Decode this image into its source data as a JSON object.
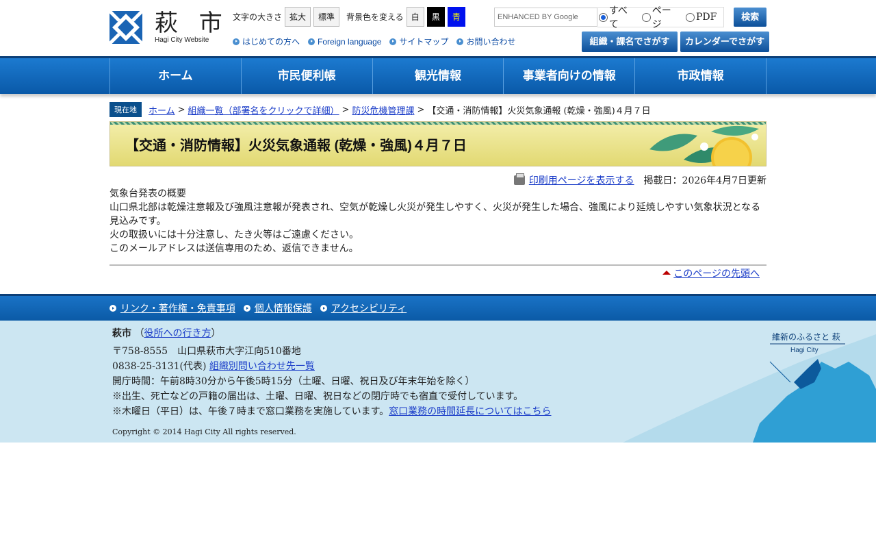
{
  "header": {
    "logo_kanji": "萩 市",
    "logo_sub": "Hagi City Website",
    "font_size_label": "文字の大きさ",
    "font_size_buttons": [
      "拡大",
      "標準"
    ],
    "bg_color_label": "背景色を変える",
    "bg_color_buttons": [
      "白",
      "黒",
      "青"
    ],
    "quicklinks": [
      "はじめての方へ",
      "Foreign language",
      "サイトマップ",
      "お問い合わせ"
    ],
    "search": {
      "placeholder": "ENHANCED BY Google",
      "options": [
        "すべて",
        "ページ",
        "PDF"
      ],
      "selected": "すべて",
      "button": "検索"
    },
    "big_buttons": [
      "組織・課名でさがす",
      "カレンダーでさがす"
    ]
  },
  "nav": [
    "ホーム",
    "市民便利帳",
    "観光情報",
    "事業者向けの情報",
    "市政情報"
  ],
  "breadcrumb": {
    "label": "現在地",
    "links": [
      "ホーム",
      "組織一覧（部署名をクリックで詳細）",
      "防災危機管理課"
    ],
    "current": "【交通・消防情報】火災気象通報 (乾燥・強風)４月７日"
  },
  "page": {
    "title": "【交通・消防情報】火災気象通報 (乾燥・強風)４月７日",
    "print_link": "印刷用ページを表示する",
    "date": "掲載日：2026年4月7日更新",
    "body": [
      "気象台発表の概要",
      "山口県北部は乾燥注意報及び強風注意報が発表され、空気が乾燥し火災が発生しやすく、火災が発生した場合、強風により延焼しやすい気象状況となる見込みです。",
      "火の取扱いには十分注意し、たき火等はご遠慮ください。",
      "このメールアドレスは送信専用のため、返信できません。"
    ],
    "pagetop": "このページの先頭へ"
  },
  "footer": {
    "links": [
      "リンク・著作権・免責事項",
      "個人情報保護",
      "アクセシビリティ"
    ],
    "name": "萩市",
    "access_link": "役所への行き方",
    "address": "〒758-8555　山口県萩市大字江向510番地",
    "phone": "0838-25-3131(代表)",
    "contact_link": "組織別問い合わせ先一覧",
    "hours": "開庁時間：午前8時30分から午後5時15分（土曜、日曜、祝日及び年末年始を除く）",
    "note1": "※出生、死亡などの戸籍の届出は、土曜、日曜、祝日などの閉庁時でも宿直で受付しています。",
    "note2": "※木曜日（平日）は、午後７時まで窓口業務を実施しています。",
    "note2_link": "窓口業務の時間延長についてはこちら",
    "copyright": "Copyright © 2014 Hagi City All rights reserved.",
    "map_label_1": "維新のふるさと 萩",
    "map_label_2": "Hagi City"
  }
}
